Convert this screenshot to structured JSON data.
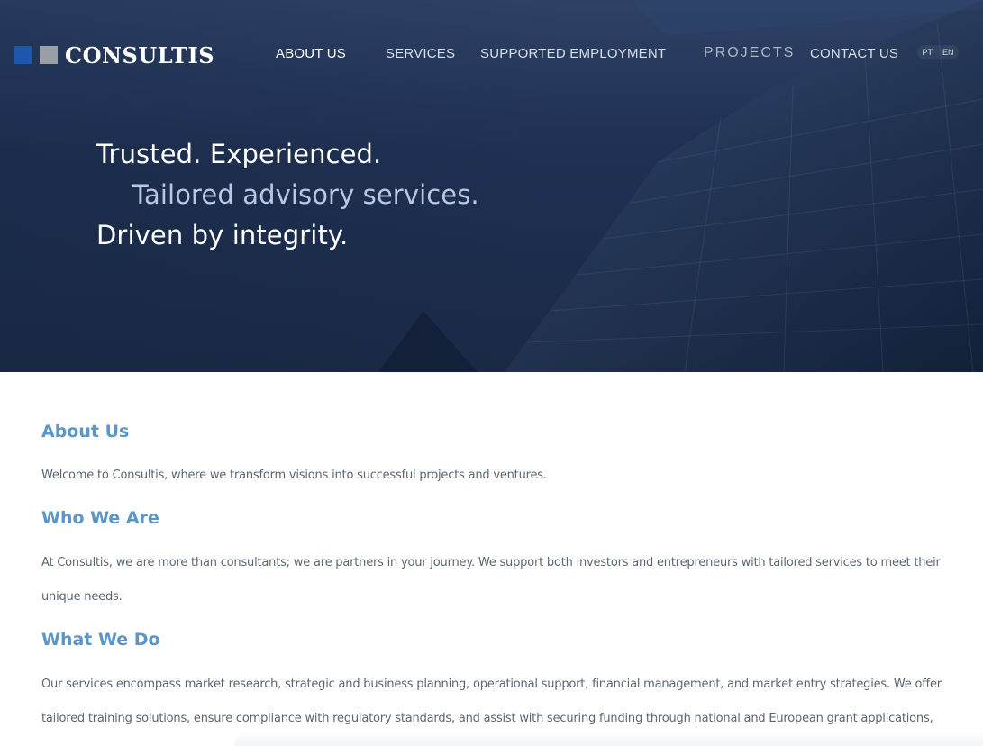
{
  "brand": {
    "name": "CONSULTIS",
    "square_colors": [
      "#1f57b0",
      "#9a9ea6"
    ]
  },
  "nav": {
    "items": [
      {
        "label": "ABOUT US",
        "active": true
      },
      {
        "label": "SERVICES"
      },
      {
        "label": "SUPPORTED EMPLOYMENT"
      },
      {
        "label": "PROJECTS"
      },
      {
        "label": "CONTACT US"
      }
    ],
    "languages": [
      "PT",
      "EN"
    ]
  },
  "hero": {
    "line1": "Trusted. Experienced.",
    "line2": "Tailored advisory services.",
    "line3": "Driven by integrity."
  },
  "sections": [
    {
      "heading": "About Us",
      "body": "Welcome to Consultis, where we transform visions into successful projects and ventures."
    },
    {
      "heading": "Who We Are",
      "body": "At Consultis, we are more than consultants; we are partners in your journey. We support both investors and entrepreneurs with tailored services to meet their unique needs."
    },
    {
      "heading": "What We Do",
      "body": "Our services encompass market research, strategic and business planning, operational support, financial management, and market entry strategies. We offer tailored training solutions, ensure compliance with regulatory standards, and assist with securing funding through national and European grant applications,"
    }
  ],
  "colors": {
    "hero_bg": "#1f3052",
    "heading": "#5a96c9",
    "body_text": "#5a6672"
  }
}
